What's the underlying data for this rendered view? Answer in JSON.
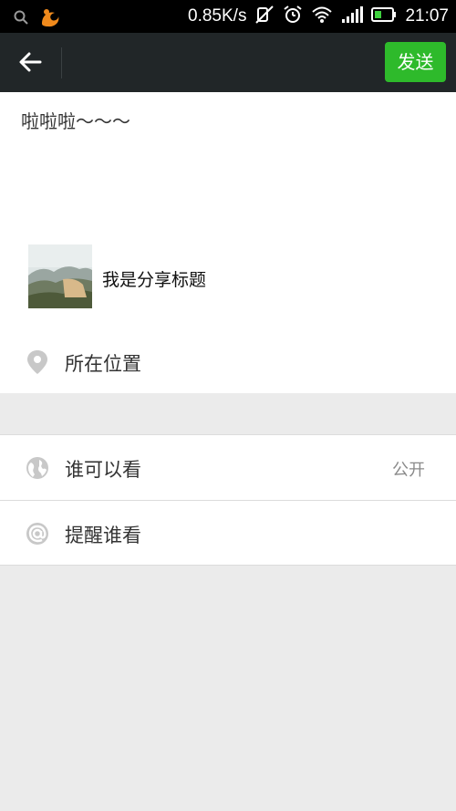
{
  "status_bar": {
    "net_speed": "0.85K/s",
    "time": "21:07",
    "icons": [
      "search-icon",
      "uc-browser-icon",
      "mute-icon",
      "alarm-icon",
      "wifi-icon",
      "signal-icon",
      "battery-icon"
    ]
  },
  "navbar": {
    "send_label": "发送",
    "back_icon": "arrow-left-icon",
    "accent": "#2eba2b"
  },
  "compose": {
    "text": "啦啦啦～～～",
    "share_title": "我是分享标题",
    "location_label": "所在位置"
  },
  "options": {
    "visibility_label": "谁可以看",
    "visibility_value": "公开",
    "mention_label": "提醒谁看"
  }
}
